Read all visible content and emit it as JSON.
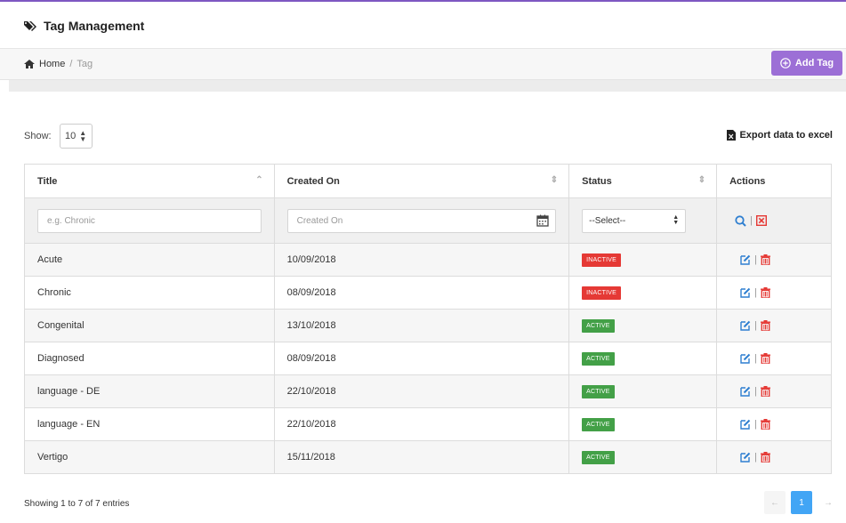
{
  "header": {
    "title": "Tag Management",
    "icon": "tags-icon"
  },
  "breadcrumb": {
    "home": "Home",
    "separator": "/",
    "current": "Tag"
  },
  "actions": {
    "add_label": "Add Tag",
    "export_label": "Export data to excel"
  },
  "length": {
    "label": "Show:",
    "value": "10"
  },
  "table": {
    "columns": [
      "Title",
      "Created On",
      "Status",
      "Actions"
    ],
    "filters": {
      "title_placeholder": "e.g. Chronic",
      "created_placeholder": "Created On",
      "status_value": "--Select--"
    },
    "rows": [
      {
        "title": "Acute",
        "created": "10/09/2018",
        "status": "INACTIVE"
      },
      {
        "title": "Chronic",
        "created": "08/09/2018",
        "status": "INACTIVE"
      },
      {
        "title": "Congenital",
        "created": "13/10/2018",
        "status": "ACTIVE"
      },
      {
        "title": "Diagnosed",
        "created": "08/09/2018",
        "status": "ACTIVE"
      },
      {
        "title": "language - DE",
        "created": "22/10/2018",
        "status": "ACTIVE"
      },
      {
        "title": "language - EN",
        "created": "22/10/2018",
        "status": "ACTIVE"
      },
      {
        "title": "Vertigo",
        "created": "15/11/2018",
        "status": "ACTIVE"
      }
    ]
  },
  "footer": {
    "info": "Showing 1 to 7 of 7 entries",
    "prev": "←",
    "page": "1",
    "next": "→"
  },
  "colors": {
    "accent": "#9c6fd6",
    "link": "#3a86c8",
    "active": "#43a047",
    "inactive": "#e53935",
    "page": "#42a5f5"
  }
}
